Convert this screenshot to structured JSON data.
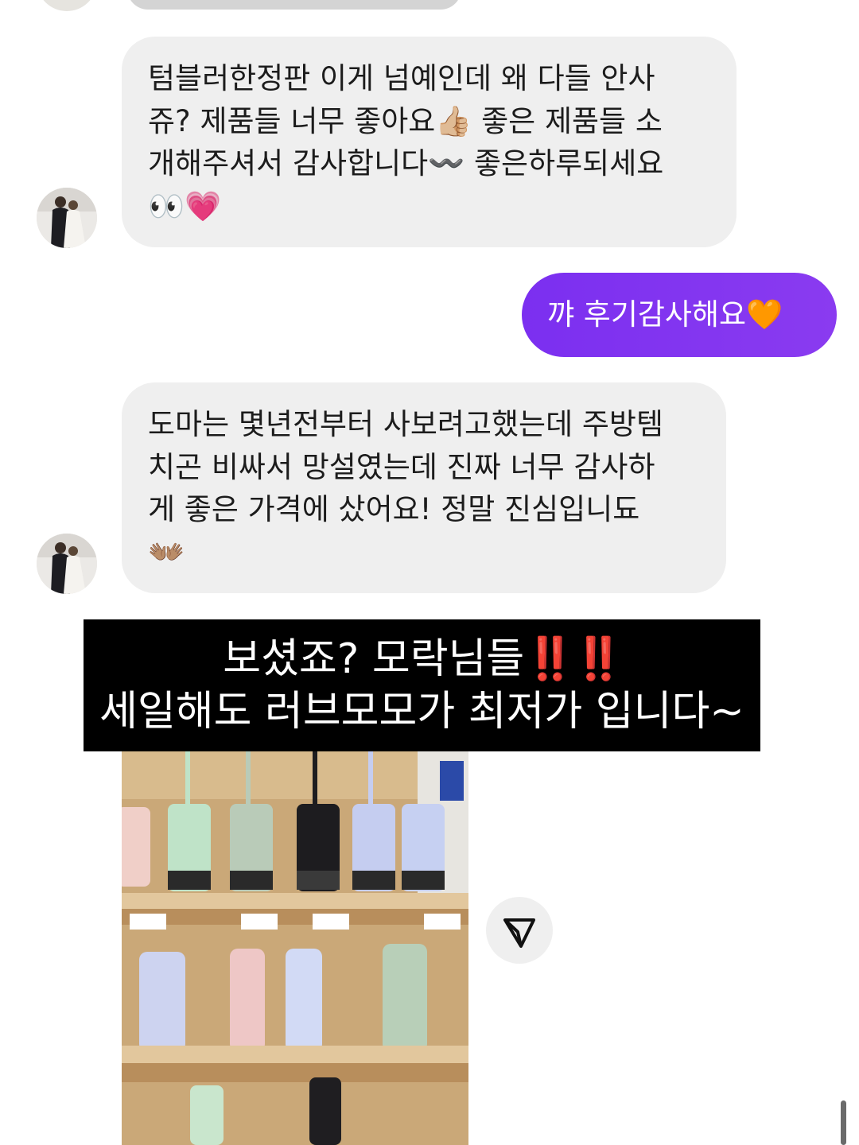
{
  "messages": {
    "msg1": {
      "lines": [
        "텀블러한정판 이게 넘예인데 왜 다들 안사",
        "쥬? 제품들 너무 좋아요👍🏼  좋은 제품들 소",
        "개해주셔서 감사합니다〰️  좋은하루되세요",
        "👀💗"
      ]
    },
    "reply": {
      "text": "꺄 후기감사해요🧡"
    },
    "msg2": {
      "lines": [
        "도마는 몇년전부터 사보려고했는데 주방템",
        "치곤 비싸서 망설였는데 진짜 너무 감사하",
        "게 좋은 가격에 샀어요! 정말 진심입니됴",
        "👐🏽"
      ]
    }
  },
  "caption": {
    "line1_text": "보셨죠? 모락님들",
    "line1_marks": "‼️‼️",
    "line2": "세일해도 러브모모가 최저가 입니다~"
  },
  "colors": {
    "incoming_bubble": "#efefef",
    "outgoing_bubble": "#7b2ff0",
    "caption_bg": "#000000",
    "exclamation": "#e2231a"
  },
  "icons": {
    "share": "paper-plane-icon"
  }
}
